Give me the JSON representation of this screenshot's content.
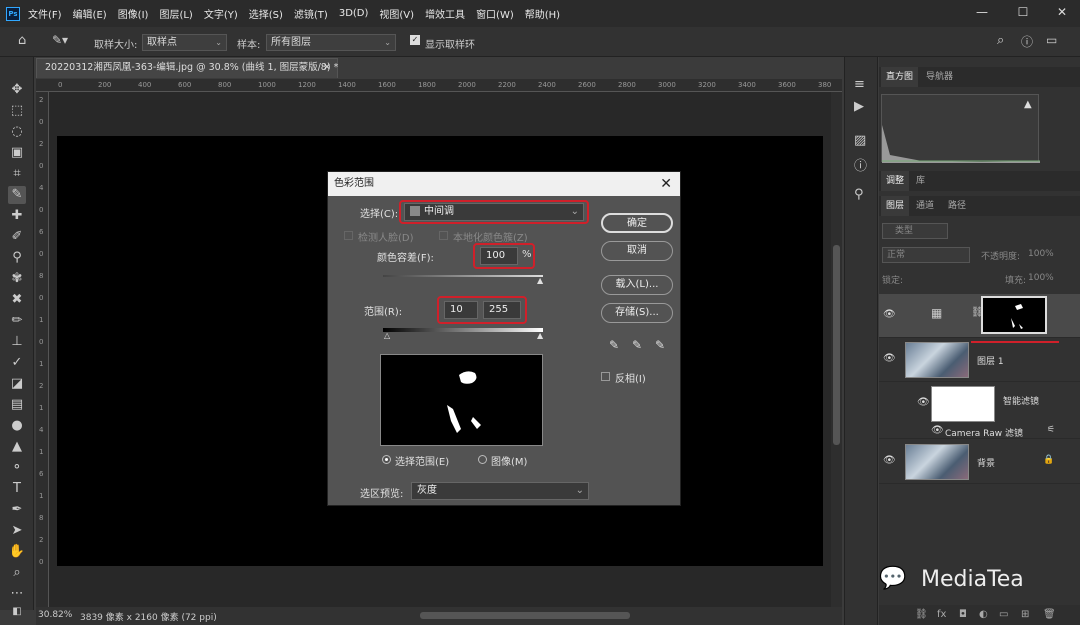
{
  "menu": [
    "文件(F)",
    "编辑(E)",
    "图像(I)",
    "图层(L)",
    "文字(Y)",
    "选择(S)",
    "滤镜(T)",
    "3D(D)",
    "视图(V)",
    "增效工具",
    "窗口(W)",
    "帮助(H)"
  ],
  "options": {
    "sample_size_label": "取样大小:",
    "sample_size_value": "取样点",
    "sample_label": "样本:",
    "sample_value": "所有图层",
    "show_ring": "显示取样环"
  },
  "doc": {
    "tab_title": "20220312湘西凤凰-363-编辑.jpg @ 30.8% (曲线 1, 图层蒙版/8) *",
    "zoom": "30.82%",
    "status": "3839 像素 x 2160 像素 (72 ppi)"
  },
  "ruler_ticks": [
    "0",
    "200",
    "400",
    "600",
    "800",
    "1000",
    "1200",
    "1400",
    "1600",
    "1800",
    "2000",
    "2200",
    "2400",
    "2600",
    "2800",
    "3000",
    "3200",
    "3400",
    "3600",
    "380"
  ],
  "ruler_left_ticks": [
    "2",
    "0",
    "2",
    "0",
    "4",
    "0",
    "6",
    "0",
    "8",
    "0",
    "1",
    "0",
    "1",
    "2",
    "1",
    "4",
    "1",
    "6",
    "1",
    "8",
    "2",
    "0"
  ],
  "dialog": {
    "title": "色彩范围",
    "select_label": "选择(C):",
    "select_value": "中间调",
    "detect_faces": "检测人脸(D)",
    "localized": "本地化颜色簇(Z)",
    "tolerance_label": "颜色容差(F):",
    "tolerance_value": "100",
    "percent": "%",
    "range_label": "范围(R):",
    "range_min": "10",
    "range_max": "255",
    "radio_selection": "选择范围(E)",
    "radio_image": "图像(M)",
    "preview_label": "选区预览:",
    "preview_value": "灰度",
    "btn_ok": "确定",
    "btn_cancel": "取消",
    "btn_load": "载入(L)...",
    "btn_save": "存储(S)...",
    "invert": "反相(I)"
  },
  "panels": {
    "tabs_top": [
      "直方图",
      "导航器"
    ],
    "tabs_mid": [
      "调整",
      "库"
    ],
    "tabs_layers": [
      "图层",
      "通道",
      "路径"
    ],
    "kind": "类型",
    "blend_mode": "正常",
    "opacity_label": "不透明度:",
    "opacity_value": "100%",
    "lock_label": "锁定:",
    "fill_label": "填充:",
    "fill_value": "100%",
    "layers": [
      {
        "name": "图层 1"
      },
      {
        "name": "智能滤镜"
      },
      {
        "name": "Camera Raw 滤镜"
      },
      {
        "name": "背景"
      }
    ]
  },
  "watermark": "MediaTea",
  "colors": {
    "accent_red": "#d0202a"
  }
}
